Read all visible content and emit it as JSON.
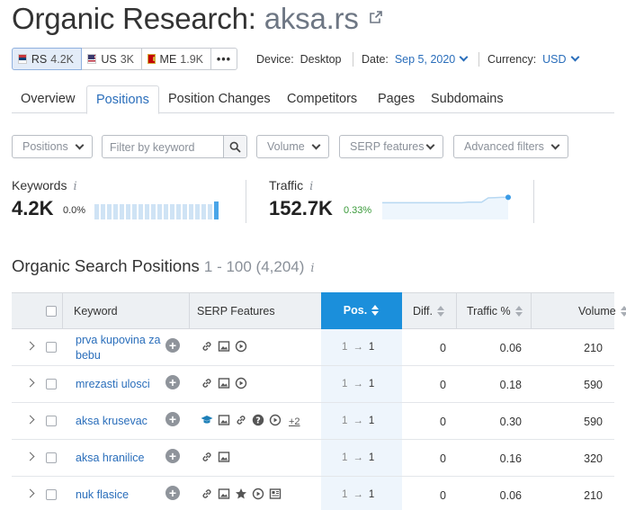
{
  "header": {
    "title_prefix": "Organic Research:",
    "domain": "aksa.rs"
  },
  "databases": [
    {
      "code": "RS",
      "count": "4.2K",
      "active": true
    },
    {
      "code": "US",
      "count": "3K",
      "active": false
    },
    {
      "code": "ME",
      "count": "1.9K",
      "active": false
    }
  ],
  "more_label": "•••",
  "meta": {
    "device_label": "Device:",
    "device_value": "Desktop",
    "date_label": "Date:",
    "date_value": "Sep 5, 2020",
    "currency_label": "Currency:",
    "currency_value": "USD"
  },
  "tabs": [
    "Overview",
    "Positions",
    "Position Changes",
    "Competitors",
    "Pages",
    "Subdomains"
  ],
  "filters": {
    "positions": "Positions",
    "keyword_placeholder": "Filter by keyword",
    "volume": "Volume",
    "serp": "SERP features",
    "advanced": "Advanced filters"
  },
  "summary": {
    "keywords_label": "Keywords",
    "keywords_value": "4.2K",
    "keywords_change": "0.0%",
    "traffic_label": "Traffic",
    "traffic_value": "152.7K",
    "traffic_change": "0.33%",
    "keywords_trend": [
      0.85,
      0.85,
      0.85,
      0.85,
      0.85,
      0.85,
      0.85,
      0.85,
      0.85,
      0.85,
      0.85,
      0.85,
      0.85,
      0.85,
      0.85,
      0.85,
      0.85,
      0.85,
      0.85,
      1.0
    ],
    "traffic_trend": [
      0.62,
      0.62,
      0.62,
      0.62,
      0.62,
      0.62,
      0.62,
      0.62,
      0.62,
      0.62,
      0.62,
      0.62,
      0.62,
      0.64,
      0.64,
      0.64,
      0.8,
      0.81,
      0.82,
      0.82
    ]
  },
  "section": {
    "title": "Organic Search Positions",
    "range": "1 - 100 (4,204)"
  },
  "table": {
    "headers": {
      "keyword": "Keyword",
      "serp": "SERP Features",
      "pos": "Pos.",
      "diff": "Diff.",
      "traffic": "Traffic %",
      "volume": "Volume"
    },
    "rows": [
      {
        "keyword": "prva kupovina za bebu",
        "serp": [
          "link",
          "image",
          "video"
        ],
        "more": "",
        "pos_prev": "1",
        "pos": "1",
        "diff": "0",
        "traffic": "0.06",
        "volume": "210"
      },
      {
        "keyword": "mrezasti ulosci",
        "serp": [
          "link",
          "image",
          "video"
        ],
        "more": "",
        "pos_prev": "1",
        "pos": "1",
        "diff": "0",
        "traffic": "0.18",
        "volume": "590"
      },
      {
        "keyword": "aksa krusevac",
        "serp": [
          "graduation",
          "image",
          "link",
          "question",
          "video"
        ],
        "more": "+2",
        "pos_prev": "1",
        "pos": "1",
        "diff": "0",
        "traffic": "0.30",
        "volume": "590"
      },
      {
        "keyword": "aksa hranilice",
        "serp": [
          "link",
          "image"
        ],
        "more": "",
        "pos_prev": "1",
        "pos": "1",
        "diff": "0",
        "traffic": "0.16",
        "volume": "320"
      },
      {
        "keyword": "nuk flasice",
        "serp": [
          "link",
          "image",
          "star",
          "video",
          "news"
        ],
        "more": "",
        "pos_prev": "1",
        "pos": "1",
        "diff": "0",
        "traffic": "0.06",
        "volume": "210"
      }
    ]
  },
  "colors": {
    "accent": "#2a6ebb",
    "pos_header": "#1b8fdb",
    "positive": "#3a9a3a"
  }
}
